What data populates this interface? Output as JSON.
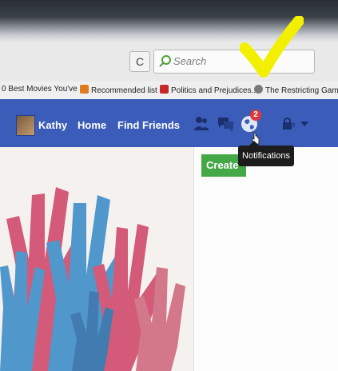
{
  "browser": {
    "search": {
      "placeholder": "Search",
      "icon": "search-icon"
    },
    "reload": {
      "icon": "reload-icon",
      "glyph": "C"
    },
    "bookmarks": [
      {
        "label": "0 Best Movies You've ...",
        "icon": "page-icon"
      },
      {
        "label": "Recommended list",
        "icon": "bookmark-icon"
      },
      {
        "label": "Politics and Prejudices...",
        "icon": "bookmark-icon"
      },
      {
        "label": "The Restricting Gam",
        "icon": "bookmark-icon"
      }
    ]
  },
  "facebook": {
    "nav": {
      "user_name": "Kathy",
      "home": "Home",
      "find_friends": "Find Friends",
      "notifications_count": "2",
      "tooltip": "Notifications"
    },
    "create_button": "Create"
  },
  "colors": {
    "fb_blue": "#3b5cb8",
    "notif_red": "#e0393b",
    "create_green": "#45a846",
    "highlight_yellow": "#f2f000"
  }
}
